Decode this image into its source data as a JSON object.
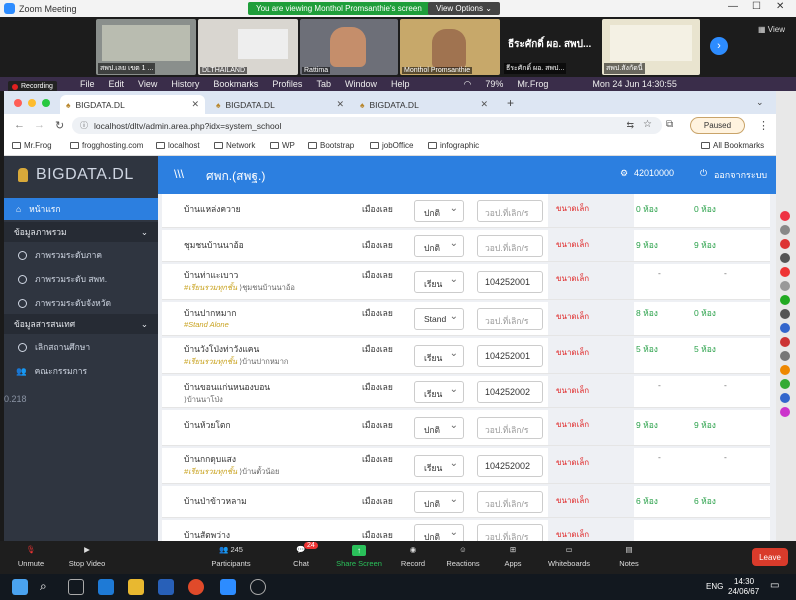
{
  "zoom": {
    "window_title": "Zoom Meeting",
    "viewing_banner": "You are viewing Monthol Promsanthie's screen",
    "view_options": "View Options",
    "view_label": "View",
    "recording": "Recording",
    "participants_tiles": [
      {
        "name": "สพป.เลย เขต 1 ..."
      },
      {
        "name": "DLTHAILAND"
      },
      {
        "name": "Rattima"
      },
      {
        "name": "Monthol Promsanthie"
      },
      {
        "name": "ธีระศักดิ์ ผอ. สพป..."
      },
      {
        "name": "สพป.สังกัดนี้"
      }
    ],
    "toolbar": {
      "unmute": "Unmute",
      "stop_video": "Stop Video",
      "participants": "Participants",
      "participants_count": "245",
      "chat": "Chat",
      "chat_badge": "24",
      "share_screen": "Share Screen",
      "record": "Record",
      "reactions": "Reactions",
      "apps": "Apps",
      "whiteboards": "Whiteboards",
      "notes": "Notes",
      "leave": "Leave"
    }
  },
  "mac_menu": {
    "items": [
      "File",
      "Edit",
      "View",
      "History",
      "Bookmarks",
      "Profiles",
      "Tab",
      "Window",
      "Help"
    ],
    "battery": "79%",
    "user": "Mr.Frog",
    "datetime": "Mon 24 Jun  14:30:55"
  },
  "browser": {
    "tabs": [
      "BIGDATA.DL",
      "BIGDATA.DL",
      "BIGDATA.DL"
    ],
    "url": "localhost/dltv/admin.area.php?idx=system_school",
    "paused": "Paused",
    "bookmarks": [
      "Mr.Frog",
      "frogghosting.com",
      "localhost",
      "Network",
      "WP",
      "Bootstrap",
      "jobOffice",
      "infographic"
    ],
    "all_bookmarks": "All Bookmarks"
  },
  "app": {
    "brand": "BIGDATA.DL",
    "topbar_title": "ศพก.(สพฐ.)",
    "user_id": "42010000",
    "logout": "ออกจากระบบ",
    "version": "0.218",
    "sidebar": {
      "home": "หน้าแรก",
      "section1": "ข้อมูลภาพรวม",
      "items1": [
        "ภาพรวมระดับภาค",
        "ภาพรวมระดับ สพท.",
        "ภาพรวมระดับจังหวัด"
      ],
      "section2": "ข้อมูลสารสนเทศ",
      "items2": [
        "เลิกสถานศึกษา"
      ],
      "committee": "คณะกรรมการ"
    },
    "rows": [
      {
        "name": "บ้านแหล่งควาย",
        "sub_tag": "",
        "sub_text": "",
        "province": "เมืองเลย",
        "status": "ปกติ",
        "code": "",
        "code_ph": "วอป.ที่เลิก/ร",
        "size": "ขนาดเล็ก",
        "c1": "0 ห้อง",
        "c2": "0 ห้อง"
      },
      {
        "name": "ชุมชนบ้านนาอ้อ",
        "sub_tag": "",
        "sub_text": "",
        "province": "เมืองเลย",
        "status": "ปกติ",
        "code": "",
        "code_ph": "วอป.ที่เลิก/ร",
        "size": "ขนาดเล็ก",
        "c1": "9 ห้อง",
        "c2": "9 ห้อง"
      },
      {
        "name": "บ้านท่าแะเบาว",
        "sub_tag": "#เรียนรวมทุกชั้น",
        "sub_text": "ชุมชนบ้านนาอ้อ",
        "province": "เมืองเลย",
        "status": "เรียน",
        "code": "104252001",
        "code_ph": "",
        "size": "ขนาดเล็ก",
        "c1": "-",
        "c2": "-"
      },
      {
        "name": "บ้านปากหมาก",
        "sub_tag": "#Stand Alone",
        "sub_text": "",
        "province": "เมืองเลย",
        "status": "Stand",
        "code": "",
        "code_ph": "วอป.ที่เลิก/ร",
        "size": "ขนาดเล็ก",
        "c1": "8 ห้อง",
        "c2": "0 ห้อง"
      },
      {
        "name": "บ้านวังโป่งท่าวังแคน",
        "sub_tag": "#เรียนรวมทุกชั้น",
        "sub_text": "บ้านปากหมาก",
        "province": "เมืองเลย",
        "status": "เรียน",
        "code": "104252001",
        "code_ph": "",
        "size": "ขนาดเล็ก",
        "c1": "5 ห้อง",
        "c2": "5 ห้อง"
      },
      {
        "name": "บ้านขอนแก่นหนองบอน",
        "sub_tag": "",
        "sub_text": "บ้านนาโป่ง",
        "province": "เมืองเลย",
        "status": "เรียน",
        "code": "104252002",
        "code_ph": "",
        "size": "ขนาดเล็ก",
        "c1": "-",
        "c2": "-"
      },
      {
        "name": "บ้านห้วยโตก",
        "sub_tag": "",
        "sub_text": "",
        "province": "เมืองเลย",
        "status": "ปกติ",
        "code": "",
        "code_ph": "วอป.ที่เลิก/ร",
        "size": "ขนาดเล็ก",
        "c1": "9 ห้อง",
        "c2": "9 ห้อง"
      },
      {
        "name": "บ้านกกดุบแสง",
        "sub_tag": "#เรียนรวมทุกชั้น",
        "sub_text": "บ้านตั้วน้อย",
        "province": "เมืองเลย",
        "status": "เรียน",
        "code": "104252002",
        "code_ph": "",
        "size": "ขนาดเล็ก",
        "c1": "-",
        "c2": "-"
      },
      {
        "name": "บ้านป่าข้าวหลาม",
        "sub_tag": "",
        "sub_text": "",
        "province": "เมืองเลย",
        "status": "ปกติ",
        "code": "",
        "code_ph": "วอป.ที่เลิก/ร",
        "size": "ขนาดเล็ก",
        "c1": "6 ห้อง",
        "c2": "6 ห้อง"
      },
      {
        "name": "บ้านสัตพว่าง",
        "sub_tag": "",
        "sub_text": "",
        "province": "เมืองเลย",
        "status": "ปกติ",
        "code": "",
        "code_ph": "วอป.ที่เลิก/ร",
        "size": "ขนาดเล็ก",
        "c1": "",
        "c2": ""
      }
    ]
  },
  "taskbar": {
    "lang": "ENG",
    "time": "14:30",
    "date": "24/06/67"
  },
  "colors": {
    "accent": "#2c7fe0",
    "sidebar": "#2f3540",
    "size_red": "#e02a2a",
    "count_green": "#2aa14a",
    "tag_yellow": "#c9a320"
  }
}
